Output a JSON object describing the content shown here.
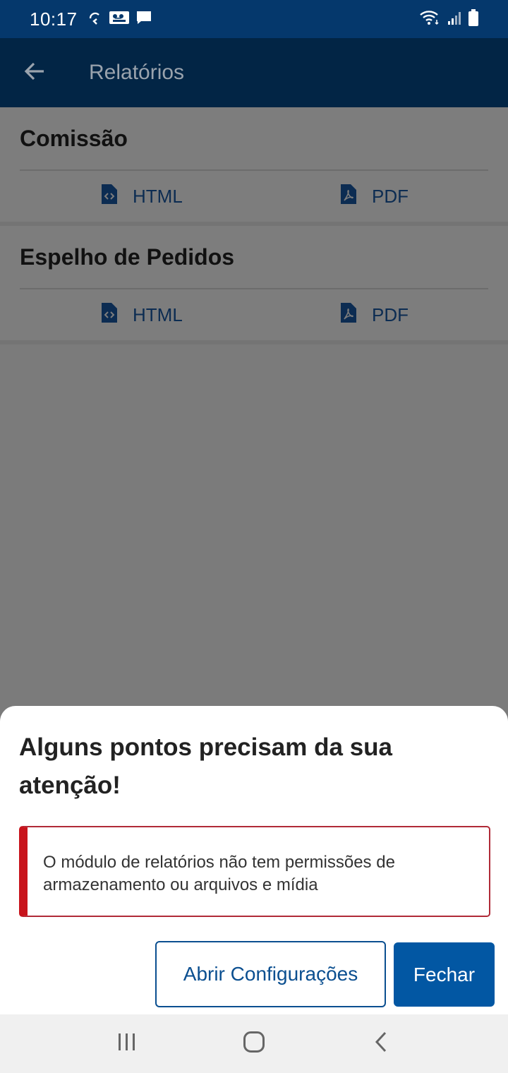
{
  "status_bar": {
    "time": "10:17",
    "left_icons": [
      "sync-icon",
      "voicemail-icon",
      "chat-icon"
    ],
    "right_icons": [
      "wifi-icon",
      "signal-icon",
      "battery-icon"
    ]
  },
  "app_bar": {
    "back_icon": "arrow-left-icon",
    "title": "Relatórios"
  },
  "reports": [
    {
      "title": "Comissão",
      "html_label": "HTML",
      "pdf_label": "PDF"
    },
    {
      "title": "Espelho de Pedidos",
      "html_label": "HTML",
      "pdf_label": "PDF"
    }
  ],
  "sheet": {
    "title": "Alguns pontos precisam da sua atenção!",
    "message": "O módulo de relatórios não tem permissões de armazenamento ou arquivos e mídia",
    "open_settings_label": "Abrir Configurações",
    "close_label": "Fechar"
  },
  "nav_bar": {
    "icons": [
      "recents-icon",
      "home-icon",
      "back-icon"
    ]
  },
  "colors": {
    "status_bar": "#05386c",
    "app_bar": "#022545",
    "primary": "#0257a3",
    "alert": "#c8141c"
  }
}
